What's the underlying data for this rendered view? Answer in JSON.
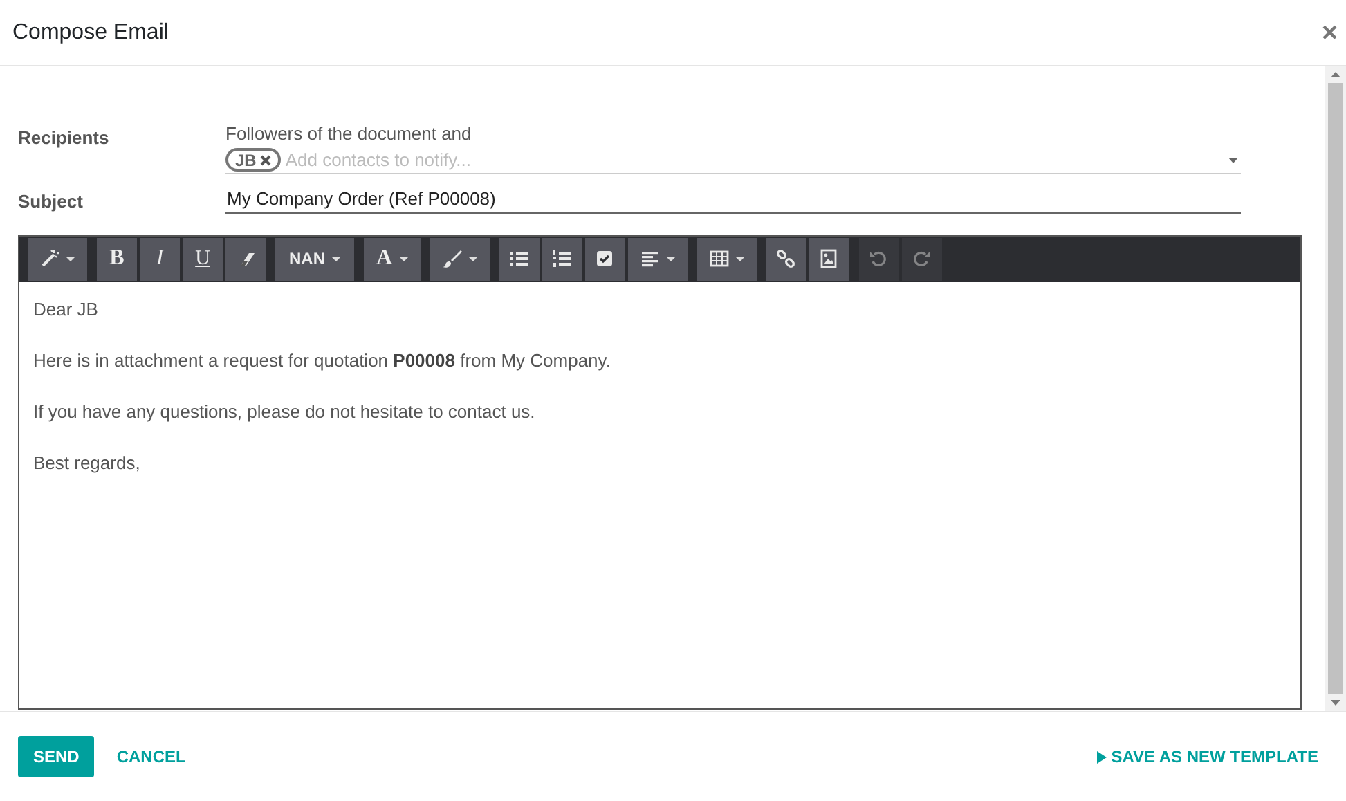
{
  "dialog": {
    "title": "Compose Email",
    "close": "×"
  },
  "recipients": {
    "label": "Recipients",
    "note": "Followers of the document and",
    "tags": [
      {
        "label": "JB"
      }
    ],
    "placeholder": "Add contacts to notify..."
  },
  "subject": {
    "label": "Subject",
    "value": "My Company Order (Ref P00008)"
  },
  "toolbar": {
    "groups": [
      {
        "items": [
          {
            "kind": "magic",
            "dropdown": true,
            "disabled": false
          }
        ]
      },
      {
        "items": [
          {
            "kind": "bold",
            "label": "B",
            "disabled": false
          },
          {
            "kind": "italic",
            "label": "I",
            "disabled": false
          },
          {
            "kind": "underline",
            "label": "U",
            "disabled": false
          },
          {
            "kind": "eraser",
            "disabled": false
          }
        ]
      },
      {
        "items": [
          {
            "kind": "text",
            "label": "NAN",
            "dropdown": true,
            "disabled": false
          }
        ]
      },
      {
        "items": [
          {
            "kind": "fontcolor",
            "label": "A",
            "dropdown": true,
            "disabled": false
          }
        ]
      },
      {
        "items": [
          {
            "kind": "brush",
            "dropdown": true,
            "disabled": false
          }
        ]
      },
      {
        "items": [
          {
            "kind": "ul",
            "disabled": false
          },
          {
            "kind": "ol",
            "disabled": false
          },
          {
            "kind": "checklist",
            "disabled": false
          },
          {
            "kind": "align",
            "dropdown": true,
            "disabled": false
          }
        ]
      },
      {
        "items": [
          {
            "kind": "table",
            "dropdown": true,
            "disabled": false
          }
        ]
      },
      {
        "items": [
          {
            "kind": "link",
            "disabled": false
          },
          {
            "kind": "image",
            "disabled": false
          }
        ]
      },
      {
        "items": [
          {
            "kind": "undo",
            "disabled": true
          },
          {
            "kind": "redo",
            "disabled": true
          }
        ]
      }
    ]
  },
  "body": [
    "Dear JB",
    "Here is in attachment a request for quotation **P00008** from My Company.",
    "If you have any questions, please do not hesitate to contact us.",
    "Best regards,"
  ],
  "footer": {
    "buttons": [
      {
        "kind": "primary",
        "label": "SEND"
      },
      {
        "kind": "link",
        "label": "CANCEL"
      },
      {
        "kind": "template",
        "label": "SAVE AS NEW TEMPLATE"
      }
    ]
  }
}
